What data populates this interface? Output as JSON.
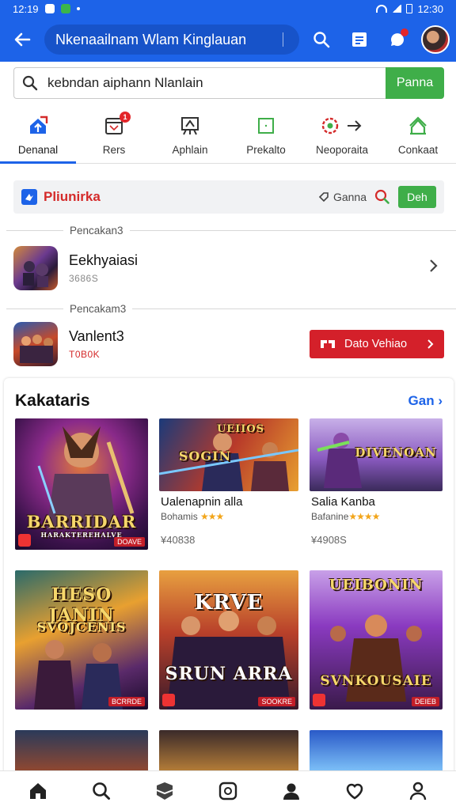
{
  "status_bar": {
    "time": "12:19",
    "clock": "12:30"
  },
  "app_bar": {
    "title": "Nkenaailnam Wlam Kinglauan"
  },
  "search": {
    "query": "kebndan aiphann Nlanlain",
    "button": "Panna"
  },
  "tabs": [
    {
      "label": "Denanal",
      "icon": "home-upload-icon",
      "color": "#1d63e8",
      "active": true
    },
    {
      "label": "Rers",
      "icon": "calendar-icon",
      "color": "#333333",
      "badge": "1"
    },
    {
      "label": "Aphlain",
      "icon": "easel-icon",
      "color": "#333333"
    },
    {
      "label": "Prekalto",
      "icon": "square-icon",
      "color": "#3fae49"
    },
    {
      "label": "Neoporaita",
      "icon": "gear-icon",
      "color": "#d42a2a"
    },
    {
      "label": "Conkaat",
      "icon": "house-outline-icon",
      "color": "#3fae49"
    }
  ],
  "platform": {
    "title": "Pliunirka",
    "filter_label": "Ganna",
    "ok_button": "Deh"
  },
  "list": {
    "section1": "Pencakan3",
    "row1": {
      "title": "Eekhyaiasi",
      "sub": "3686S"
    },
    "section2": "Pencakam3",
    "row2": {
      "title": "Vanlent3",
      "sub": "T0B0K",
      "button": "Dato Vehiao"
    }
  },
  "card": {
    "title": "Kakataris",
    "more": "Gan",
    "tiles": [
      {
        "art": "BARRIDAR",
        "art_sub": "HARAKTEREHALVE",
        "tag": "DOAVE"
      },
      {
        "art": "SOGIN",
        "art_top": "UEIIOS",
        "caption": "Ualenapnin alla",
        "meta": "Bohamis",
        "stars": "★★★",
        "price": "¥40838"
      },
      {
        "art": "DIVENOAN",
        "caption": "Salia Kanba",
        "meta": "Bafanine",
        "stars": "★★★★",
        "price": "¥4908S"
      },
      {
        "art": "HESO JANIN",
        "art_sub": "SVOJCENIS",
        "tag": "BCRRDE"
      },
      {
        "art": "KRVE",
        "art_sub": "SRUN ARRA",
        "tag": "SOOKRE"
      },
      {
        "art": "UEIBONIN",
        "art_sub": "SVNKOUSAIE",
        "tag": "DEIEB"
      }
    ]
  },
  "bottom_nav": [
    {
      "name": "home-icon"
    },
    {
      "name": "search-icon"
    },
    {
      "name": "game-icon"
    },
    {
      "name": "camera-icon"
    },
    {
      "name": "person-icon"
    },
    {
      "name": "heart-icon"
    },
    {
      "name": "profile-icon"
    }
  ],
  "colors": {
    "primary": "#1d63e8",
    "accent_green": "#3fae49",
    "accent_red": "#d42a2a"
  }
}
